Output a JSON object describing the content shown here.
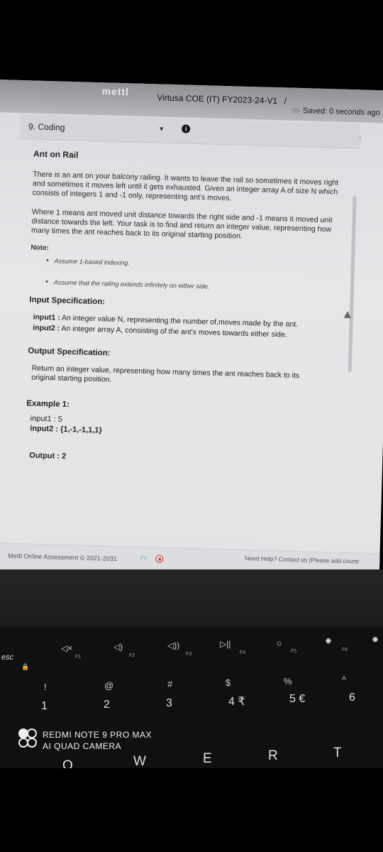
{
  "header": {
    "logo": "mettl",
    "course": "Virtusa COE (IT) FY2023-24-V1",
    "separator": "/",
    "saved": "Saved: 0 seconds ago"
  },
  "question": {
    "number": "9. Coding",
    "title": "Ant on Rail",
    "para1": "There is an ant on your balcony railing. It wants to leave the rail so sometimes it moves right and sometimes it moves left until it gets exhausted. Given an integer array A of size N which consists of integers 1 and -1 only, representing ant's moves.",
    "para2": "Where 1 means ant moved unit distance towards the right side and -1 means it moved unit distance towards the left. Your task is to find and return an integer value, representing how many times the ant reaches back to its original starting position.",
    "note_heading": "Note:",
    "notes": [
      "Assume 1-based indexing.",
      "Assume that the railing extends infinitely on either side."
    ],
    "input_heading": "Input Specification:",
    "input1_label": "input1 :",
    "input1_text": "An integer value N, representing the number of,moves made by the ant.",
    "input2_label": "input2 :",
    "input2_text": "An integer array A, consisting of the ant's moves towards either side.",
    "output_heading": "Output Specification:",
    "output_text": "Return an integer value, representing how many times the ant reaches back to its original starting position.",
    "example_heading": "Example 1:",
    "example_input1": "input1 : 5",
    "example_input2": "input2 : {1,-1,-1,1,1}",
    "example_output": "Output : 2"
  },
  "footer": {
    "copyright": "Mettl Online Assessment © 2021-2031",
    "help": "Need Help? Contact us (Please add countr"
  },
  "keyboard": {
    "esc": "esc",
    "f1": "F1",
    "f2": "F2",
    "f3": "F3",
    "f4": "F4",
    "f5": "F5",
    "f6": "F6",
    "sym_row": [
      "!",
      "@",
      "#",
      "$",
      "%",
      "^"
    ],
    "num_row": [
      "1",
      "2",
      "3",
      "4 ₹",
      "5 €",
      "6"
    ],
    "letters": [
      "Q",
      "W",
      "E",
      "R",
      "T"
    ]
  },
  "watermark": {
    "line1": "REDMI NOTE 9 PRO MAX",
    "line2": "AI QUAD CAMERA"
  }
}
